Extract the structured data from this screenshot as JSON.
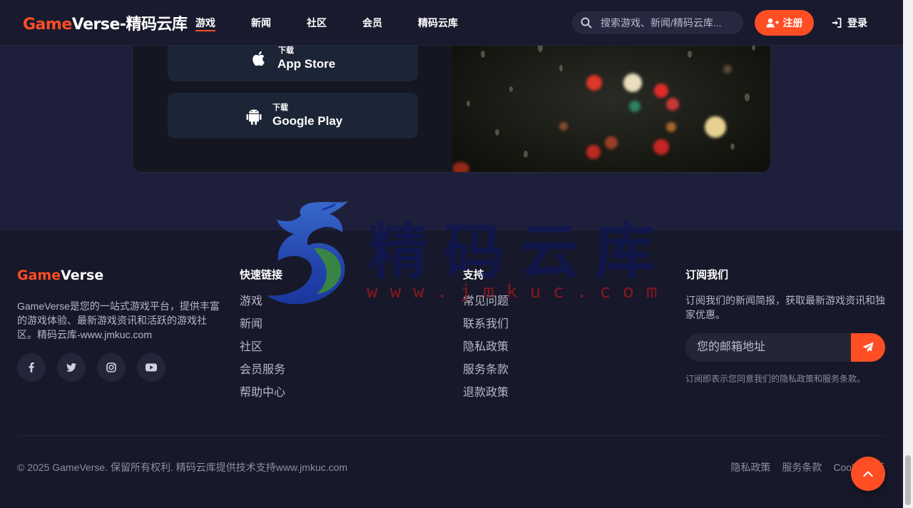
{
  "header": {
    "logo_accent": "Game",
    "logo_rest": "Verse-精码云库",
    "nav": [
      {
        "label": "游戏",
        "active": true
      },
      {
        "label": "新闻"
      },
      {
        "label": "社区"
      },
      {
        "label": "会员"
      },
      {
        "label": "精码云库"
      }
    ],
    "search_placeholder": "搜索游戏、新闻/精码云库...",
    "register_label": "注册",
    "login_label": "登录"
  },
  "download": {
    "app_store": {
      "small": "下载",
      "big": "App Store",
      "icon": "apple-icon"
    },
    "google_play": {
      "small": "下载",
      "big": "Google Play",
      "icon": "android-icon"
    }
  },
  "footer": {
    "logo_accent": "Game",
    "logo_rest": "Verse",
    "description": "GameVerse是您的一站式游戏平台，提供丰富的游戏体验、最新游戏资讯和活跃的游戏社区。精码云库-www.jmkuc.com",
    "socials": [
      "facebook-icon",
      "twitter-icon",
      "instagram-icon",
      "youtube-icon"
    ],
    "quick_links": {
      "title": "快速链接",
      "items": [
        "游戏",
        "新闻",
        "社区",
        "会员服务",
        "帮助中心"
      ]
    },
    "support": {
      "title": "支持",
      "items": [
        "常见问题",
        "联系我们",
        "隐私政策",
        "服务条款",
        "退款政策"
      ]
    },
    "subscribe": {
      "title": "订阅我们",
      "description": "订阅我们的新闻简报，获取最新游戏资讯和独家优惠。",
      "placeholder": "您的邮箱地址",
      "note": "订阅即表示您同意我们的隐私政策和服务条款。"
    },
    "copyright": "© 2025 GameVerse. 保留所有权利. 精码云库提供技术支持www.jmkuc.com",
    "bottom_links": [
      "隐私政策",
      "服务条款",
      "Cookie政策"
    ]
  },
  "watermark": {
    "text": "精码云库",
    "url": "www.jmkuc.com"
  },
  "colors": {
    "accent": "#ff4d24",
    "header_bg": "#191a2e",
    "page_bg": "#1e1f3b",
    "footer_bg": "#171829"
  }
}
